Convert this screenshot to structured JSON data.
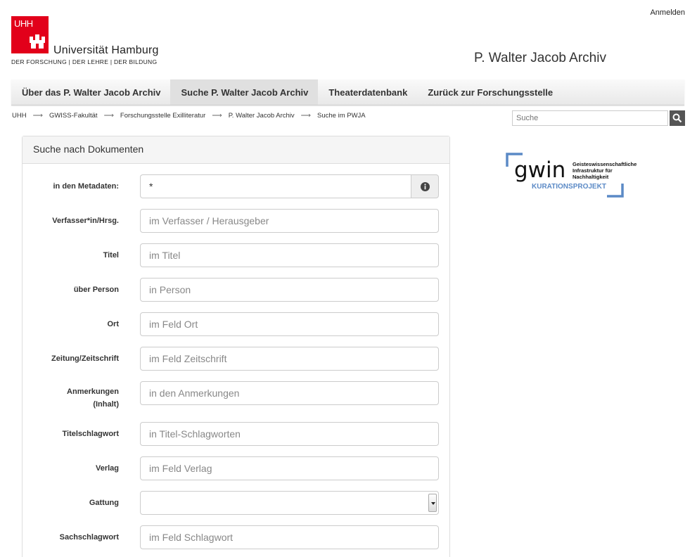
{
  "header": {
    "login_label": "Anmelden",
    "logo": {
      "short": "UHH",
      "name": "Universität Hamburg",
      "tagline": "DER FORSCHUNG | DER LEHRE | DER BILDUNG"
    },
    "site_title": "P. Walter Jacob Archiv",
    "brand_color": "#e2001a"
  },
  "nav": [
    {
      "label": "Über das P. Walter Jacob Archiv",
      "active": false
    },
    {
      "label": "Suche P. Walter Jacob Archiv",
      "active": true
    },
    {
      "label": "Theaterdatenbank",
      "active": false
    },
    {
      "label": "Zurück zur Forschungsstelle",
      "active": false
    }
  ],
  "breadcrumb": [
    "UHH",
    "GWISS-Fakultät",
    "Forschungsstelle Exilliteratur",
    "P. Walter Jacob Archiv",
    "Suche im PWJA"
  ],
  "breadcrumb_sep": "⟶",
  "search": {
    "placeholder": "Suche"
  },
  "form": {
    "title": "Suche nach Dokumenten",
    "fields": [
      {
        "label": "in den Metadaten:",
        "value": "*",
        "placeholder": ""
      },
      {
        "label": "Verfasser*in/Hrsg.",
        "placeholder": "im Verfasser / Herausgeber"
      },
      {
        "label": "Titel",
        "placeholder": "im Titel"
      },
      {
        "label": "über Person",
        "placeholder": "in Person"
      },
      {
        "label": "Ort",
        "placeholder": "im Feld Ort"
      },
      {
        "label": "Zeitung/Zeitschrift",
        "placeholder": "im Feld Zeitschrift"
      },
      {
        "label": "Anmerkungen",
        "label2": "(Inhalt)",
        "placeholder": "in den Anmerkungen"
      },
      {
        "label": "Titelschlagwort",
        "placeholder": "in Titel-Schlagworten"
      },
      {
        "label": "Verlag",
        "placeholder": "im Feld Verlag"
      },
      {
        "label": "Gattung",
        "selected": ""
      },
      {
        "label": "Sachschlagwort",
        "placeholder": "im Feld Schlagwort"
      }
    ]
  },
  "gwin": {
    "word": "gwin",
    "line1": "Geisteswissenschaftliche",
    "line2": "Infrastruktur für",
    "line3": "Nachhaltigkeit",
    "subtitle": "KURATIONSPROJEKT",
    "accent": "#5b8ac6"
  }
}
